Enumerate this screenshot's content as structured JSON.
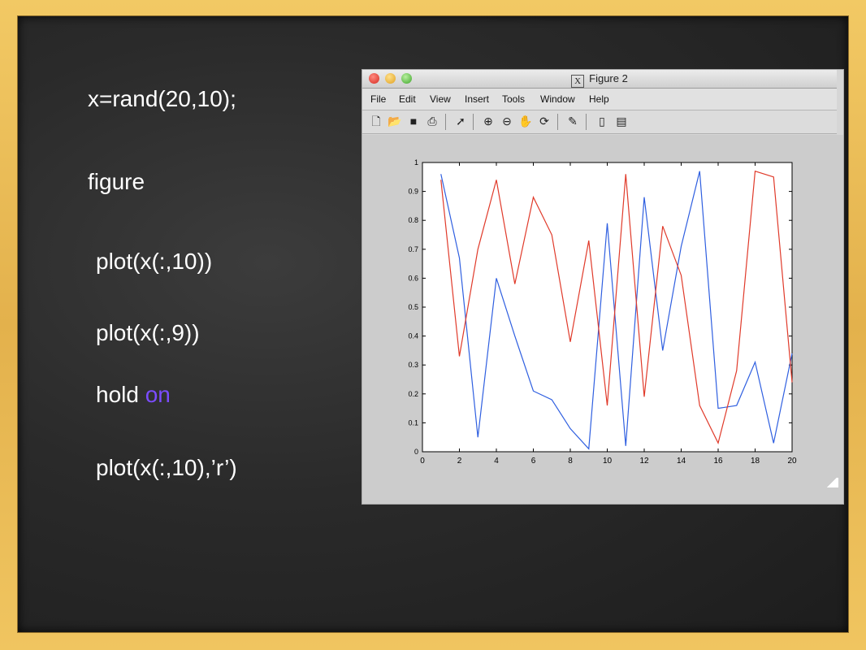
{
  "code_lines": [
    {
      "text": "x=rand(20,10);"
    },
    {
      "text": "figure"
    },
    {
      "text": "plot(x(:,10))"
    },
    {
      "text": "plot(x(:,9))"
    },
    {
      "prefix": "hold ",
      "keyword": "on"
    },
    {
      "text": "plot(x(:,10),’r’)"
    }
  ],
  "window": {
    "title": "Figure 2",
    "title_icon": "X",
    "menu": [
      "File",
      "Edit",
      "View",
      "Insert",
      "Tools",
      "Window",
      "Help"
    ],
    "toolbar_icons": [
      "new-file-icon",
      "open-folder-icon",
      "save-icon",
      "print-icon",
      "pointer-arrow-icon",
      "zoom-in-icon",
      "zoom-out-icon",
      "pan-hand-icon",
      "rotate-3d-icon",
      "data-cursor-icon",
      "colorbar-icon",
      "legend-icon"
    ]
  },
  "colors": {
    "series_blue": "#2f5fe0",
    "series_red": "#e03a2a",
    "keyword": "#7b4cff"
  },
  "chart_data": {
    "type": "line",
    "title": "",
    "xlabel": "",
    "ylabel": "",
    "xlim": [
      0,
      20
    ],
    "ylim": [
      0,
      1
    ],
    "xticks": [
      0,
      2,
      4,
      6,
      8,
      10,
      12,
      14,
      16,
      18,
      20
    ],
    "yticks": [
      0,
      0.1,
      0.2,
      0.3,
      0.4,
      0.5,
      0.6,
      0.7,
      0.8,
      0.9,
      1
    ],
    "ytick_labels": [
      "0",
      "0.1",
      "0.2",
      "0.3",
      "0.4",
      "0.5",
      "0.6",
      "0.7",
      "0.8",
      "0.9",
      "1"
    ],
    "grid": false,
    "x": [
      1,
      2,
      3,
      4,
      5,
      6,
      7,
      8,
      9,
      10,
      11,
      12,
      13,
      14,
      15,
      16,
      17,
      18,
      19,
      20
    ],
    "series": [
      {
        "color": "#2f5fe0",
        "values": [
          0.96,
          0.67,
          0.05,
          0.6,
          0.4,
          0.21,
          0.18,
          0.08,
          0.01,
          0.79,
          0.02,
          0.88,
          0.35,
          0.71,
          0.97,
          0.15,
          0.16,
          0.31,
          0.03,
          0.34
        ]
      },
      {
        "color": "#e03a2a",
        "values": [
          0.94,
          0.33,
          0.7,
          0.94,
          0.58,
          0.88,
          0.75,
          0.38,
          0.73,
          0.16,
          0.96,
          0.19,
          0.78,
          0.61,
          0.16,
          0.03,
          0.28,
          0.97,
          0.95,
          0.24
        ]
      }
    ]
  }
}
